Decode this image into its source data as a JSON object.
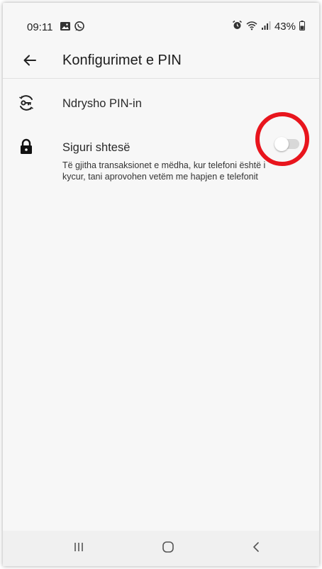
{
  "status_bar": {
    "time": "09:11",
    "left_icons": [
      "gallery-icon",
      "whatsapp-icon"
    ],
    "right_icons": [
      "alarm-icon",
      "wifi-icon",
      "signal-icon"
    ],
    "battery": "43%"
  },
  "header": {
    "title": "Konfigurimet e PIN",
    "back_icon": "arrow-left-icon"
  },
  "settings": {
    "change_pin": {
      "label": "Ndrysho PIN-in",
      "icon": "key-rotate-icon"
    },
    "extra_security": {
      "label": "Siguri shtesë",
      "description": "Të gjitha transaksionet e mëdha, kur telefoni është i kycur, tani aprovohen vetëm me hapjen e telefonit",
      "icon": "lock-icon",
      "toggle_on": false
    }
  },
  "annotation": {
    "highlight_color": "#e8151d"
  },
  "nav_bar": {
    "buttons": [
      "recents-icon",
      "home-icon",
      "back-icon"
    ]
  }
}
